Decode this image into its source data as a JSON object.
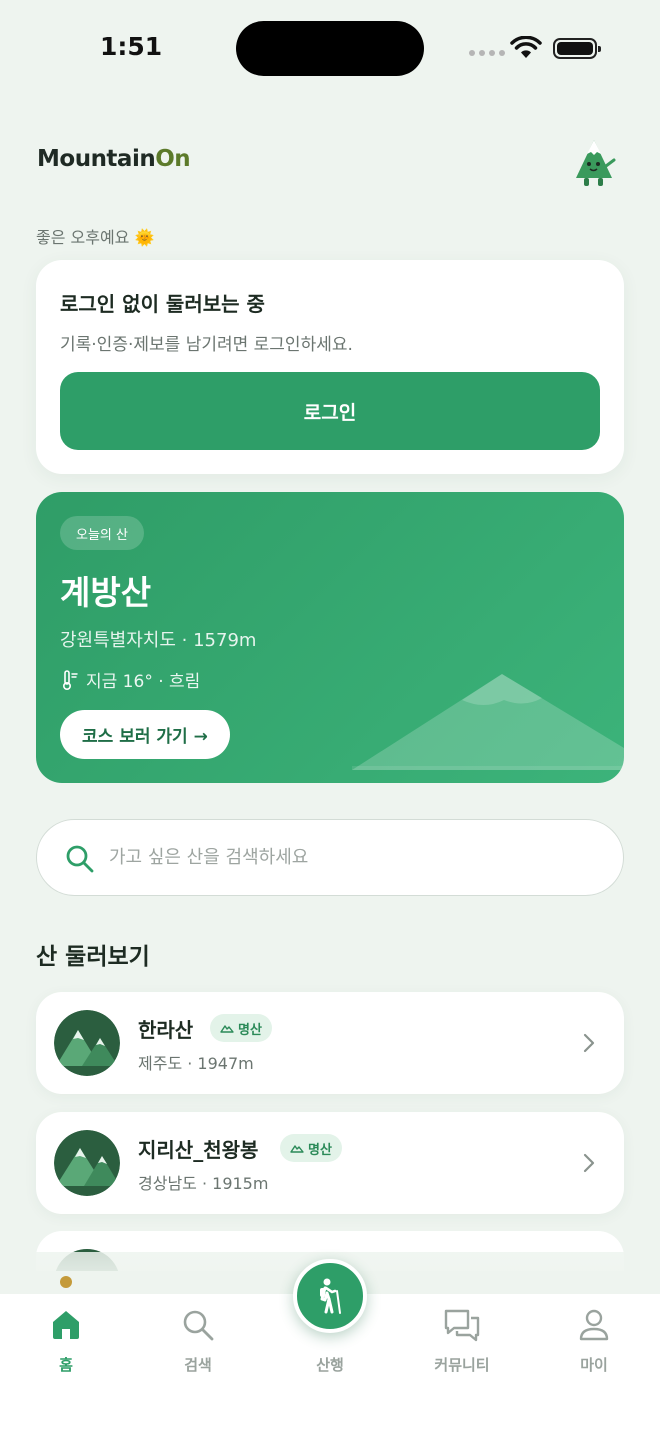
{
  "status_bar": {
    "time": "1:51"
  },
  "header": {
    "logo_main": "Mountain",
    "logo_accent": "On"
  },
  "greeting": "좋은 오후예요 🌞",
  "login_card": {
    "title": "로그인 없이 둘러보는 중",
    "description": "기록·인증·제보를 남기려면 로그인하세요.",
    "button_label": "로그인"
  },
  "today_mountain": {
    "badge": "오늘의 산",
    "name": "계방산",
    "region": "강원특별자치도 · 1579m",
    "weather": "지금 16° · 흐림",
    "button_label": "코스 보러 가기 →"
  },
  "search": {
    "placeholder": "가고 싶은 산을 검색하세요"
  },
  "explore": {
    "title": "산 둘러보기",
    "items": [
      {
        "name": "한라산",
        "badge": "명산",
        "info": "제주도 · 1947m"
      },
      {
        "name": "지리산_천왕봉",
        "badge": "명산",
        "info": "경상남도 · 1915m"
      }
    ]
  },
  "tabs": [
    {
      "label": "홈",
      "icon": "home-icon",
      "active": true
    },
    {
      "label": "검색",
      "icon": "search-icon",
      "active": false
    },
    {
      "label": "산행",
      "icon": "hiker-icon",
      "active": false
    },
    {
      "label": "커뮤니티",
      "icon": "chat-icon",
      "active": false
    },
    {
      "label": "마이",
      "icon": "person-icon",
      "active": false
    }
  ],
  "colors": {
    "primary": "#2e9e68",
    "background": "#eef4ef",
    "accent_dot": "#c49a3a"
  }
}
